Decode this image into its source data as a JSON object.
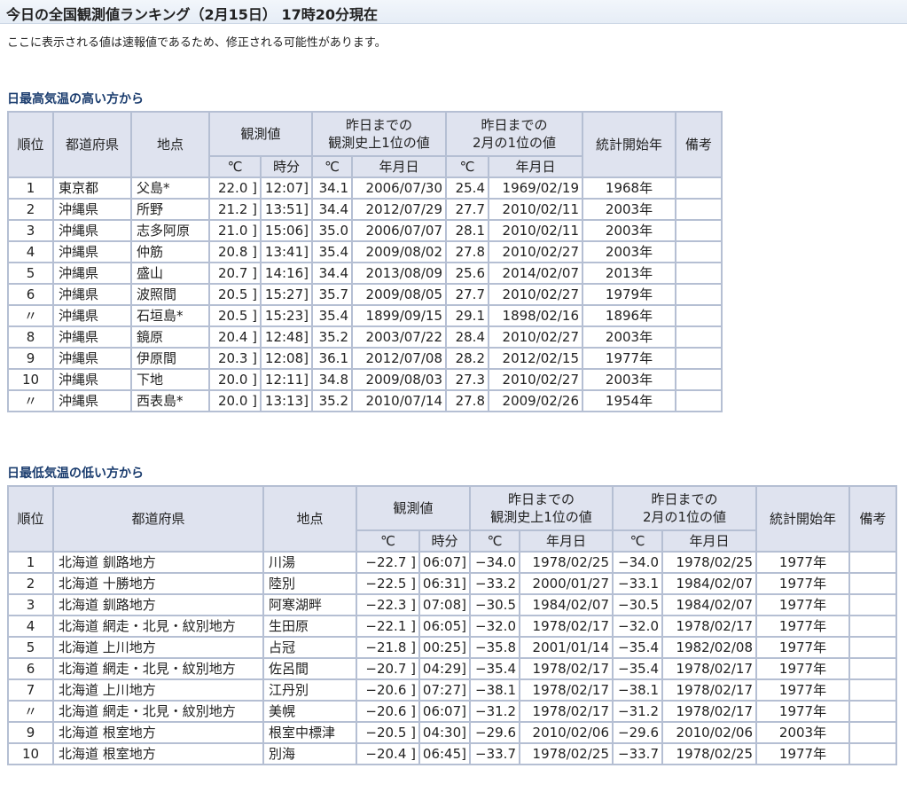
{
  "header": {
    "title": "今日の全国観測値ランキング（2月15日） 17時20分現在",
    "notice": "ここに表示される値は速報値であるため、修正される可能性があります。"
  },
  "headers": {
    "rank": "順位",
    "prefecture": "都道府県",
    "location": "地点",
    "observed": "観測値",
    "record_line1": "昨日までの",
    "record_line2": "観測史上1位の値",
    "month_line1": "昨日までの",
    "month_line2": "2月の1位の値",
    "stats_start": "統計開始年",
    "remarks": "備考",
    "celsius": "℃",
    "time": "時分",
    "date": "年月日"
  },
  "high_section": {
    "title": "日最高気温の高い方から",
    "rows": [
      {
        "rank": "1",
        "pref": "東京都",
        "loc": "父島*",
        "val": "22.0 ]",
        "time": "12:07]",
        "rec": "34.1",
        "rec_date": "2006/07/30",
        "mon": "25.4",
        "mon_date": "1969/02/19",
        "start": "1968年",
        "note": ""
      },
      {
        "rank": "2",
        "pref": "沖縄県",
        "loc": "所野",
        "val": "21.2 ]",
        "time": "13:51]",
        "rec": "34.4",
        "rec_date": "2012/07/29",
        "mon": "27.7",
        "mon_date": "2010/02/11",
        "start": "2003年",
        "note": ""
      },
      {
        "rank": "3",
        "pref": "沖縄県",
        "loc": "志多阿原",
        "val": "21.0 ]",
        "time": "15:06]",
        "rec": "35.0",
        "rec_date": "2006/07/07",
        "mon": "28.1",
        "mon_date": "2010/02/11",
        "start": "2003年",
        "note": ""
      },
      {
        "rank": "4",
        "pref": "沖縄県",
        "loc": "仲筋",
        "val": "20.8 ]",
        "time": "13:41]",
        "rec": "35.4",
        "rec_date": "2009/08/02",
        "mon": "27.8",
        "mon_date": "2010/02/27",
        "start": "2003年",
        "note": ""
      },
      {
        "rank": "5",
        "pref": "沖縄県",
        "loc": "盛山",
        "val": "20.7 ]",
        "time": "14:16]",
        "rec": "34.4",
        "rec_date": "2013/08/09",
        "mon": "25.6",
        "mon_date": "2014/02/07",
        "start": "2013年",
        "note": ""
      },
      {
        "rank": "6",
        "pref": "沖縄県",
        "loc": "波照間",
        "val": "20.5 ]",
        "time": "15:27]",
        "rec": "35.7",
        "rec_date": "2009/08/05",
        "mon": "27.7",
        "mon_date": "2010/02/27",
        "start": "1979年",
        "note": ""
      },
      {
        "rank": "〃",
        "pref": "沖縄県",
        "loc": "石垣島*",
        "val": "20.5 ]",
        "time": "15:23]",
        "rec": "35.4",
        "rec_date": "1899/09/15",
        "mon": "29.1",
        "mon_date": "1898/02/16",
        "start": "1896年",
        "note": ""
      },
      {
        "rank": "8",
        "pref": "沖縄県",
        "loc": "鏡原",
        "val": "20.4 ]",
        "time": "12:48]",
        "rec": "35.2",
        "rec_date": "2003/07/22",
        "mon": "28.4",
        "mon_date": "2010/02/27",
        "start": "2003年",
        "note": ""
      },
      {
        "rank": "9",
        "pref": "沖縄県",
        "loc": "伊原間",
        "val": "20.3 ]",
        "time": "12:08]",
        "rec": "36.1",
        "rec_date": "2012/07/08",
        "mon": "28.2",
        "mon_date": "2012/02/15",
        "start": "1977年",
        "note": ""
      },
      {
        "rank": "10",
        "pref": "沖縄県",
        "loc": "下地",
        "val": "20.0 ]",
        "time": "12:11]",
        "rec": "34.8",
        "rec_date": "2009/08/03",
        "mon": "27.3",
        "mon_date": "2010/02/27",
        "start": "2003年",
        "note": ""
      },
      {
        "rank": "〃",
        "pref": "沖縄県",
        "loc": "西表島*",
        "val": "20.0 ]",
        "time": "13:13]",
        "rec": "35.2",
        "rec_date": "2010/07/14",
        "mon": "27.8",
        "mon_date": "2009/02/26",
        "start": "1954年",
        "note": ""
      }
    ]
  },
  "low_section": {
    "title": "日最低気温の低い方から",
    "rows": [
      {
        "rank": "1",
        "pref": "北海道 釧路地方",
        "loc": "川湯",
        "val": "−22.7 ]",
        "time": "06:07]",
        "rec": "−34.0",
        "rec_date": "1978/02/25",
        "mon": "−34.0",
        "mon_date": "1978/02/25",
        "start": "1977年",
        "note": ""
      },
      {
        "rank": "2",
        "pref": "北海道 十勝地方",
        "loc": "陸別",
        "val": "−22.5 ]",
        "time": "06:31]",
        "rec": "−33.2",
        "rec_date": "2000/01/27",
        "mon": "−33.1",
        "mon_date": "1984/02/07",
        "start": "1977年",
        "note": ""
      },
      {
        "rank": "3",
        "pref": "北海道 釧路地方",
        "loc": "阿寒湖畔",
        "val": "−22.3 ]",
        "time": "07:08]",
        "rec": "−30.5",
        "rec_date": "1984/02/07",
        "mon": "−30.5",
        "mon_date": "1984/02/07",
        "start": "1977年",
        "note": ""
      },
      {
        "rank": "4",
        "pref": "北海道 網走・北見・紋別地方",
        "loc": "生田原",
        "val": "−22.1 ]",
        "time": "06:05]",
        "rec": "−32.0",
        "rec_date": "1978/02/17",
        "mon": "−32.0",
        "mon_date": "1978/02/17",
        "start": "1977年",
        "note": ""
      },
      {
        "rank": "5",
        "pref": "北海道 上川地方",
        "loc": "占冠",
        "val": "−21.8 ]",
        "time": "00:25]",
        "rec": "−35.8",
        "rec_date": "2001/01/14",
        "mon": "−35.4",
        "mon_date": "1982/02/08",
        "start": "1977年",
        "note": ""
      },
      {
        "rank": "6",
        "pref": "北海道 網走・北見・紋別地方",
        "loc": "佐呂間",
        "val": "−20.7 ]",
        "time": "04:29]",
        "rec": "−35.4",
        "rec_date": "1978/02/17",
        "mon": "−35.4",
        "mon_date": "1978/02/17",
        "start": "1977年",
        "note": ""
      },
      {
        "rank": "7",
        "pref": "北海道 上川地方",
        "loc": "江丹別",
        "val": "−20.6 ]",
        "time": "07:27]",
        "rec": "−38.1",
        "rec_date": "1978/02/17",
        "mon": "−38.1",
        "mon_date": "1978/02/17",
        "start": "1977年",
        "note": ""
      },
      {
        "rank": "〃",
        "pref": "北海道 網走・北見・紋別地方",
        "loc": "美幌",
        "val": "−20.6 ]",
        "time": "06:07]",
        "rec": "−31.2",
        "rec_date": "1978/02/17",
        "mon": "−31.2",
        "mon_date": "1978/02/17",
        "start": "1977年",
        "note": ""
      },
      {
        "rank": "9",
        "pref": "北海道 根室地方",
        "loc": "根室中標津",
        "val": "−20.5 ]",
        "time": "04:30]",
        "rec": "−29.6",
        "rec_date": "2010/02/06",
        "mon": "−29.6",
        "mon_date": "2010/02/06",
        "start": "2003年",
        "note": ""
      },
      {
        "rank": "10",
        "pref": "北海道 根室地方",
        "loc": "別海",
        "val": "−20.4 ]",
        "time": "06:45]",
        "rec": "−33.7",
        "rec_date": "1978/02/25",
        "mon": "−33.7",
        "mon_date": "1978/02/25",
        "start": "1977年",
        "note": ""
      }
    ]
  }
}
